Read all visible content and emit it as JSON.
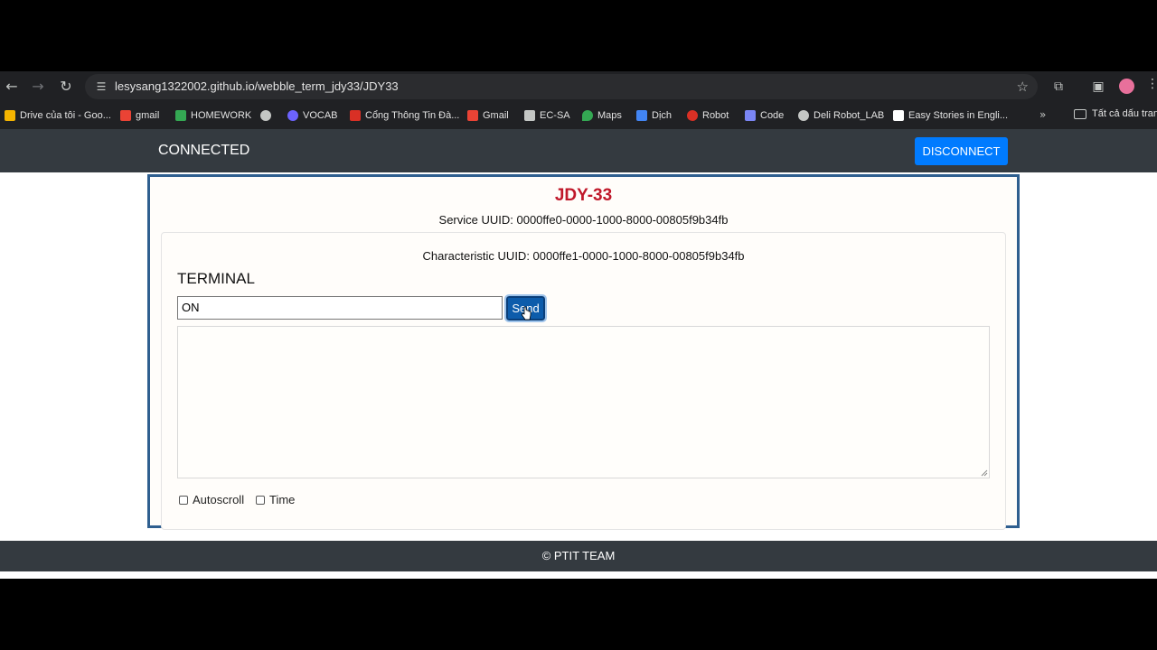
{
  "browser": {
    "url": "lesysang1322002.github.io/webble_term_jdy33/JDY33",
    "bookmarks": [
      {
        "label": "Drive của tôi - Goo...",
        "icon": "google-drive-icon",
        "color": "#f5b400"
      },
      {
        "label": "gmail",
        "icon": "gmail-icon",
        "color": "#ea4335"
      },
      {
        "label": "HOMEWORK",
        "icon": "homework-icon",
        "color": "#34a853"
      },
      {
        "label": "",
        "icon": "globe-icon",
        "color": "#c4c7c5"
      },
      {
        "label": "VOCAB",
        "icon": "vocab-icon",
        "color": "#6c63ff"
      },
      {
        "label": "Cổng Thông Tin Đà...",
        "icon": "portal-icon",
        "color": "#d93025"
      },
      {
        "label": "Gmail",
        "icon": "gmail-icon",
        "color": "#ea4335"
      },
      {
        "label": "EC-SA",
        "icon": "ec-sa-icon",
        "color": "#c4c7c5"
      },
      {
        "label": "Maps",
        "icon": "maps-icon",
        "color": "#34a853"
      },
      {
        "label": "Dịch",
        "icon": "translate-icon",
        "color": "#4285f4"
      },
      {
        "label": "Robot",
        "icon": "robot-icon",
        "color": "#d93025"
      },
      {
        "label": "Code",
        "icon": "code-icon",
        "color": "#7b86f5"
      },
      {
        "label": "Deli Robot_LAB",
        "icon": "globe-icon",
        "color": "#c4c7c5"
      },
      {
        "label": "Easy Stories in Engli...",
        "icon": "stories-icon",
        "color": "#ffffff"
      }
    ],
    "all_bookmarks_label": "Tất cả dấu trang"
  },
  "navbar": {
    "status": "CONNECTED",
    "disconnect_label": "DISCONNECT"
  },
  "device": {
    "name": "JDY-33",
    "service_uuid": "Service UUID: 0000ffe0-0000-1000-8000-00805f9b34fb",
    "characteristic_uuid": "Characteristic UUID: 0000ffe1-0000-1000-8000-00805f9b34fb"
  },
  "terminal": {
    "heading": "TERMINAL",
    "input_value": "ON",
    "send_label": "Send",
    "log_text": "",
    "autoscroll_label": "Autoscroll",
    "time_label": "Time"
  },
  "footer": {
    "text": "© PTIT TEAM"
  }
}
